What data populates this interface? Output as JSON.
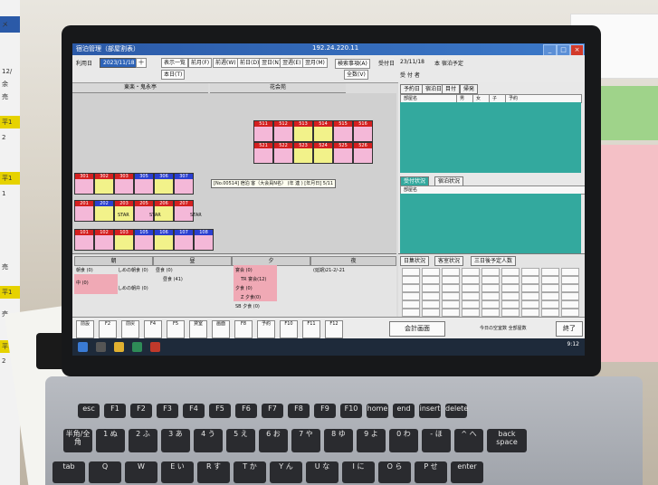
{
  "window": {
    "title": "宿泊管理（部屋割表）",
    "center_title": "192.24.220.11",
    "min": "_",
    "max": "□",
    "close": "×"
  },
  "toolbar": {
    "date_label": "利用日",
    "date_value": "2023/11/18",
    "date_btn": "十",
    "buttons": [
      "表示一覧",
      "前月(F)",
      "前週(W)",
      "前日(D)",
      "翌日(N)",
      "翌週(E)",
      "翌月(M)"
    ],
    "today_btn": "本日(T)",
    "search_btn": "検索事項(A)",
    "all_btn": "全数(V)",
    "receipt_label": "受付日",
    "receipt_value": "23/11/18",
    "status_text": "本 宿泊予定",
    "receipt_sub": "受 付 者"
  },
  "left_panel": {
    "heading_a": "東楽・鬼永亭",
    "heading_b": "花会苑",
    "tooltip": "[No.00514] 宿泊 客（大会員N名） (年 連 ) [年月日] 5/11",
    "row_labels": [
      "STAR",
      "STAR",
      "STAR"
    ]
  },
  "rooms_top": [
    {
      "no": "511",
      "color": "#d42020"
    },
    {
      "no": "512",
      "color": "#d42020"
    },
    {
      "no": "513",
      "color": "#d42020"
    },
    {
      "no": "514",
      "color": "#d42020"
    },
    {
      "no": "515",
      "color": "#d42020"
    },
    {
      "no": "516",
      "color": "#d42020"
    },
    {
      "no": "521",
      "color": "#d42020"
    },
    {
      "no": "522",
      "color": "#d42020"
    },
    {
      "no": "523",
      "color": "#d42020"
    },
    {
      "no": "524",
      "color": "#d42020"
    },
    {
      "no": "525",
      "color": "#d42020"
    },
    {
      "no": "526",
      "color": "#d42020"
    }
  ],
  "rooms_mid": [
    {
      "no": "301",
      "color": "#d42020"
    },
    {
      "no": "302",
      "color": "#d42020"
    },
    {
      "no": "303",
      "color": "#d42020"
    },
    {
      "no": "305",
      "color": "#2a3fd0"
    },
    {
      "no": "306",
      "color": "#2a3fd0"
    },
    {
      "no": "307",
      "color": "#2a3fd0"
    }
  ],
  "rooms_row3": [
    {
      "no": "201",
      "color": "#d42020"
    },
    {
      "no": "202",
      "color": "#2a3fd0"
    },
    {
      "no": "203",
      "color": "#d42020"
    },
    {
      "no": "205",
      "color": "#d42020"
    },
    {
      "no": "206",
      "color": "#d42020"
    },
    {
      "no": "207",
      "color": "#d42020"
    }
  ],
  "rooms_row4": [
    {
      "no": "101",
      "color": "#d42020"
    },
    {
      "no": "102",
      "color": "#d42020"
    },
    {
      "no": "103",
      "color": "#d42020"
    },
    {
      "no": "105",
      "color": "#2a3fd0"
    },
    {
      "no": "106",
      "color": "#2a3fd0"
    },
    {
      "no": "107",
      "color": "#2a3fd0"
    },
    {
      "no": "108",
      "color": "#2a3fd0"
    }
  ],
  "right_panel": {
    "tabs": [
      "予約日",
      "宿泊日",
      "目付",
      "帰発"
    ],
    "cols": [
      "部屋名",
      "男",
      "女",
      "子",
      "予約"
    ],
    "lower_tabs": [
      "受付状況",
      "宿泊状況"
    ],
    "lower_cols": [
      "部屋名",
      "予約数",
      "計",
      "予",
      "確",
      "男",
      "女",
      "子",
      "計"
    ]
  },
  "lower_panel": {
    "headers": [
      "朝",
      "昼",
      "夕",
      "夜"
    ],
    "items": [
      "朝食 (0)",
      "しめの朝食 (0)",
      "しめの朝弁 (0)",
      "中 (0)",
      "昼食 (0)",
      "昼食 (41)",
      "宴会 (0)",
      "TR 宴会(12)",
      "夕食 (0)",
      "Z 夕食(0)",
      "SB 夕食 (0)",
      "(延期)21-2/-21"
    ],
    "stats_tabs": [
      "日集状況",
      "客室状況",
      "三日後予定人数"
    ]
  },
  "fkeys": {
    "keys": [
      "前設",
      "F2",
      "前戻",
      "F4",
      "F5",
      "貸室",
      "画面",
      "F8",
      "予約",
      "F10",
      "F11",
      "F12"
    ],
    "big_button": "会計画面",
    "right_text": "今日の空室数 全部屋数",
    "end_button": "終了"
  },
  "taskbar": {
    "time": "9:12"
  },
  "keyboard": {
    "row1": [
      "esc",
      "F1",
      "F2",
      "F3",
      "F4",
      "F5",
      "F6",
      "F7",
      "F8",
      "F9",
      "F10",
      "home",
      "end",
      "insert",
      "delete"
    ],
    "row2": [
      "半角/全角",
      "1 ぬ",
      "2 ふ",
      "3 あ",
      "4 う",
      "5 え",
      "6 お",
      "7 や",
      "8 ゆ",
      "9 よ",
      "0 わ",
      "- ほ",
      "^ へ",
      "back space"
    ],
    "row3": [
      "tab",
      "Q",
      "W",
      "E い",
      "R す",
      "T か",
      "Y ん",
      "U な",
      "I に",
      "O ら",
      "P せ",
      "enter"
    ]
  },
  "left_strip": {
    "labels": [
      "メ",
      "12/",
      "余",
      "売",
      "平1",
      "2",
      "平1",
      "1",
      "売",
      "平1",
      "売",
      "平1",
      "2"
    ]
  },
  "colors": {
    "titlebar": "#2b5aa8",
    "teal": "#33a99e",
    "room_red": "#d42020",
    "room_blue": "#2a3fd0",
    "room_pink": "#f4b8d8",
    "room_yellow": "#f2f28a"
  }
}
